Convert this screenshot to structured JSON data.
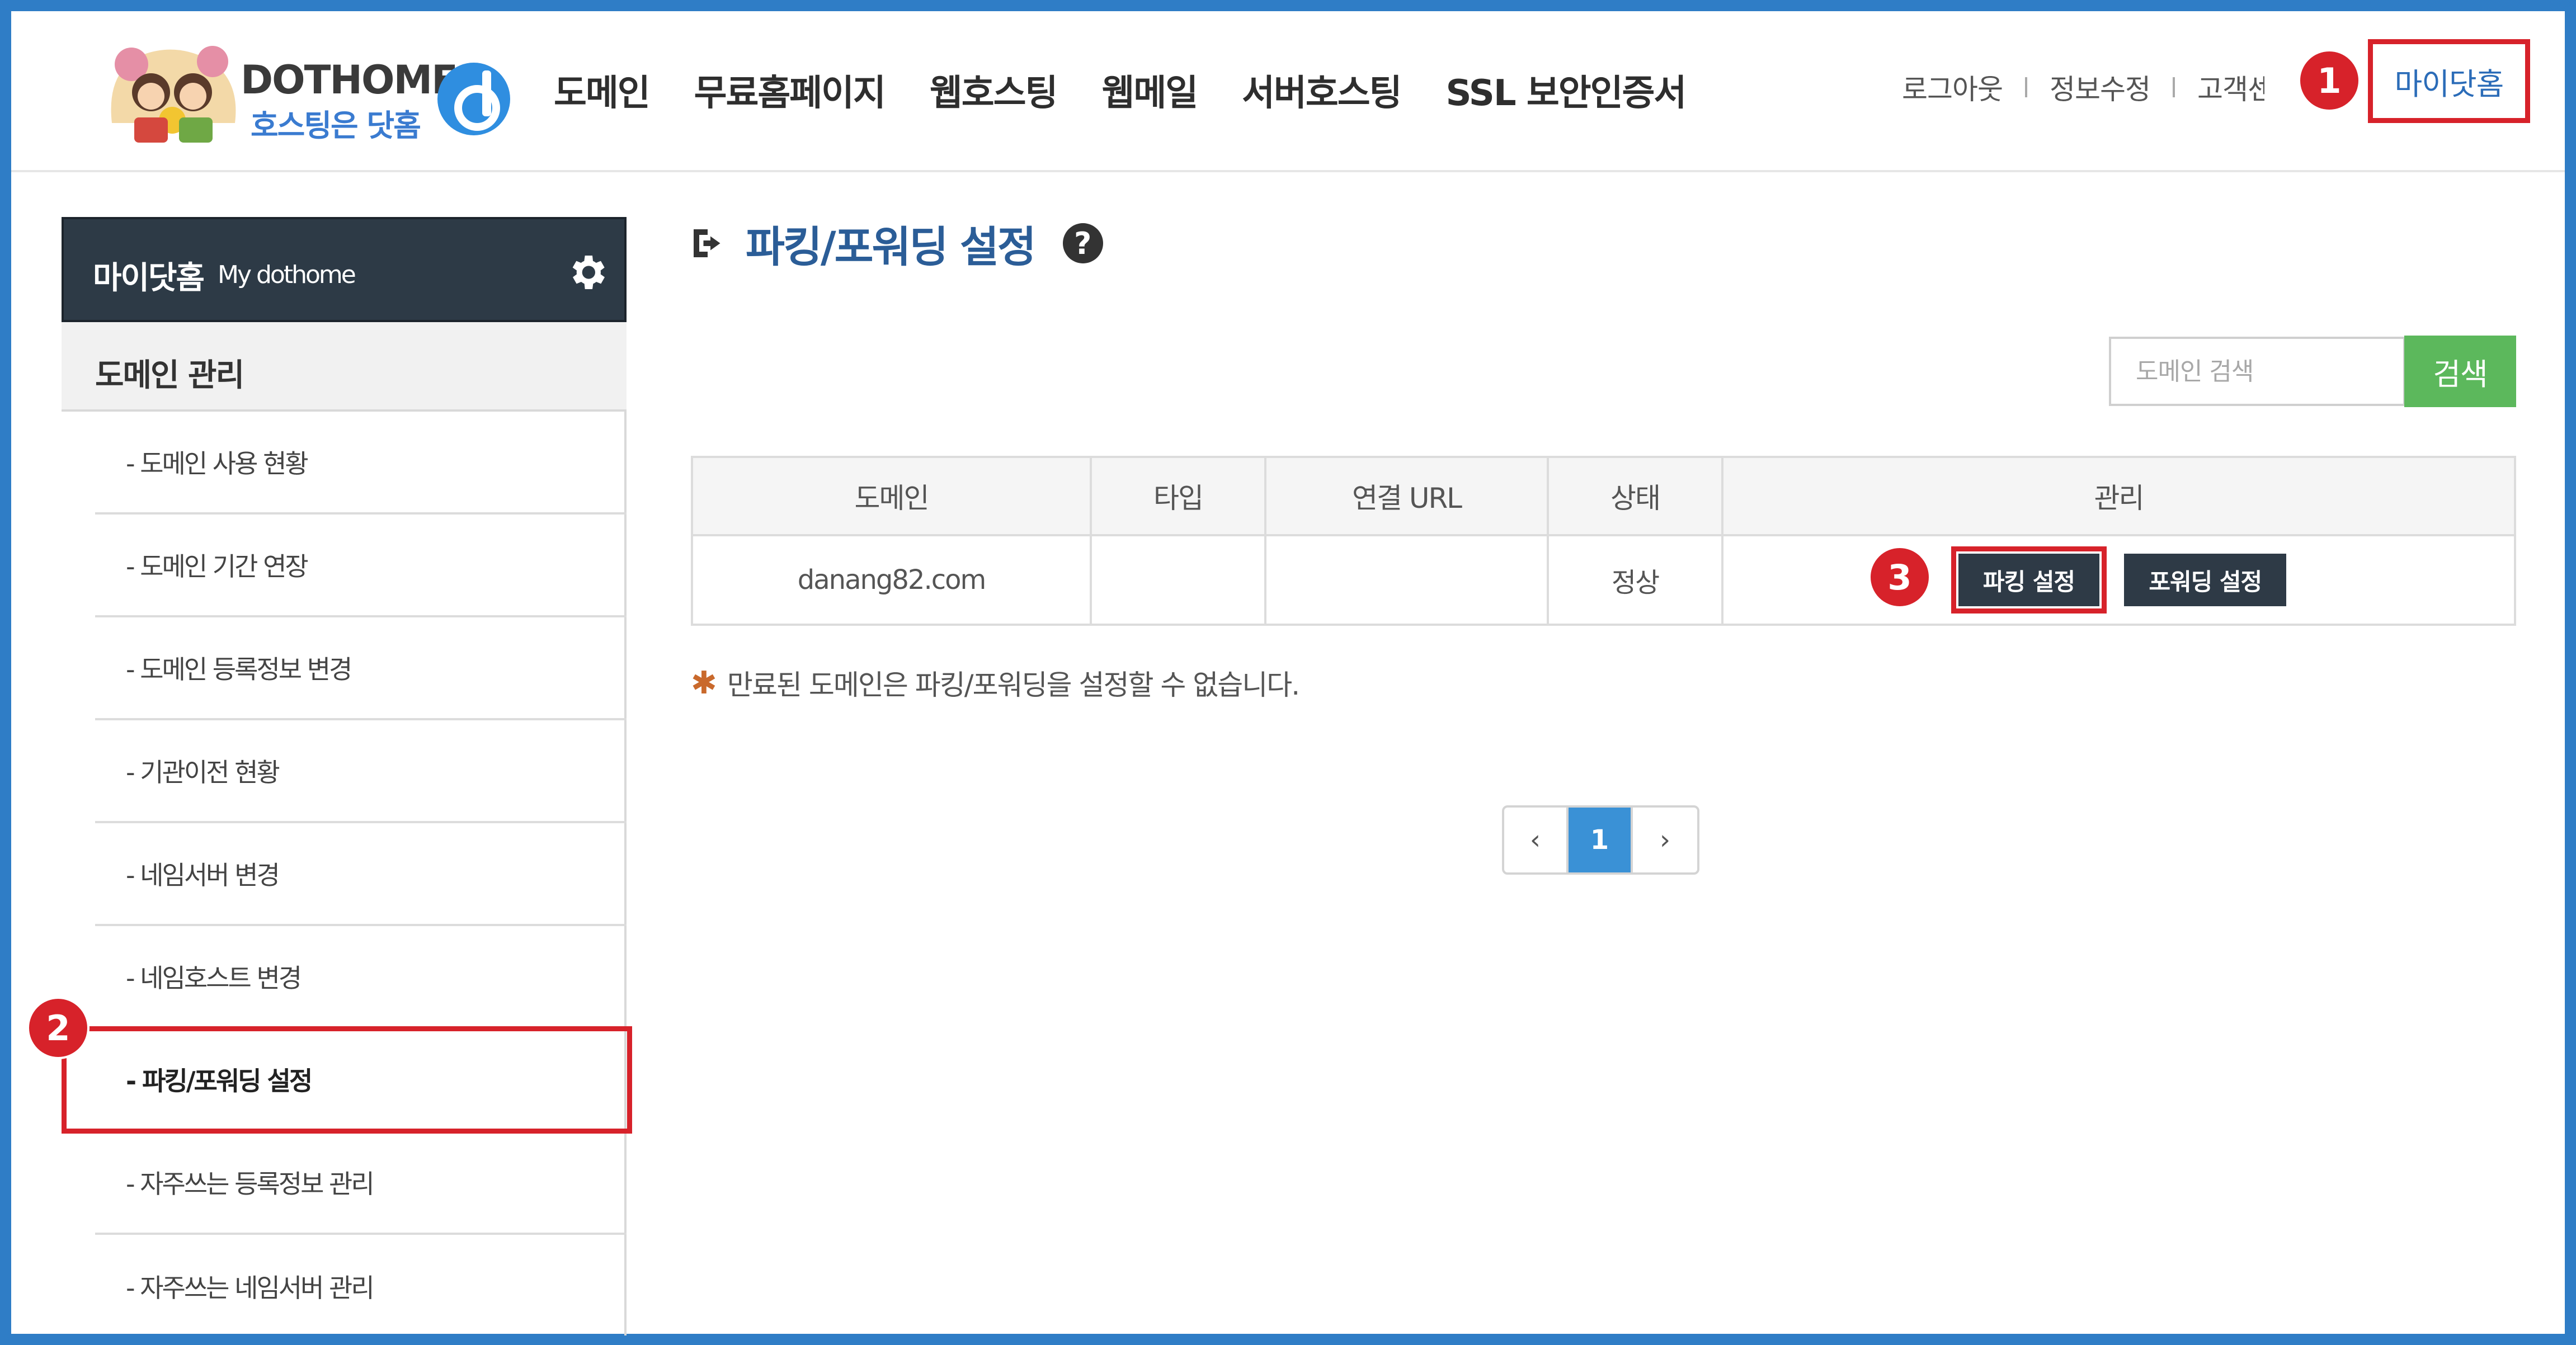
{
  "header": {
    "logo_en": "DOTHOME",
    "logo_ko": "호스팅은 닷홈",
    "nav": [
      "도메인",
      "무료홈페이지",
      "웹호스팅",
      "웹메일",
      "서버호스팅",
      "SSL 보안인증서"
    ],
    "util": [
      "로그아웃",
      "정보수정",
      "고객센"
    ],
    "my_dothome": "마이닷홈"
  },
  "steps": [
    "1",
    "2",
    "3"
  ],
  "sidebar": {
    "title": "마이닷홈",
    "subtitle": "My dothome",
    "section": "도메인 관리",
    "items": [
      "- 도메인 사용 현황",
      "- 도메인 기간 연장",
      "- 도메인 등록정보 변경",
      "- 기관이전 현황",
      "- 네임서버 변경",
      "- 네임호스트 변경",
      "- 파킹/포워딩 설정",
      "- 자주쓰는 등록정보 관리",
      "- 자주쓰는 네임서버 관리"
    ]
  },
  "main": {
    "title": "파킹/포워딩 설정",
    "help": "?",
    "search": {
      "placeholder": "도메인 검색",
      "button": "검색"
    },
    "table": {
      "headers": [
        "도메인",
        "타입",
        "연결 URL",
        "상태",
        "관리"
      ],
      "rows": [
        {
          "domain": "danang82.com",
          "type": "",
          "url": "",
          "status": "정상",
          "actions": [
            "파킹 설정",
            "포워딩 설정"
          ]
        }
      ]
    },
    "notice_star": "✱",
    "notice": "만료된 도메인은 파킹/포워딩을 설정할 수 없습니다.",
    "pagination": {
      "prev": "‹",
      "current": "1",
      "next": "›"
    }
  },
  "colors": {
    "frame": "#2f7dc6",
    "highlight": "#d7222a",
    "search_button": "#5cb85c",
    "dark_button": "#2e3a46",
    "page_active": "#3a91d6"
  }
}
